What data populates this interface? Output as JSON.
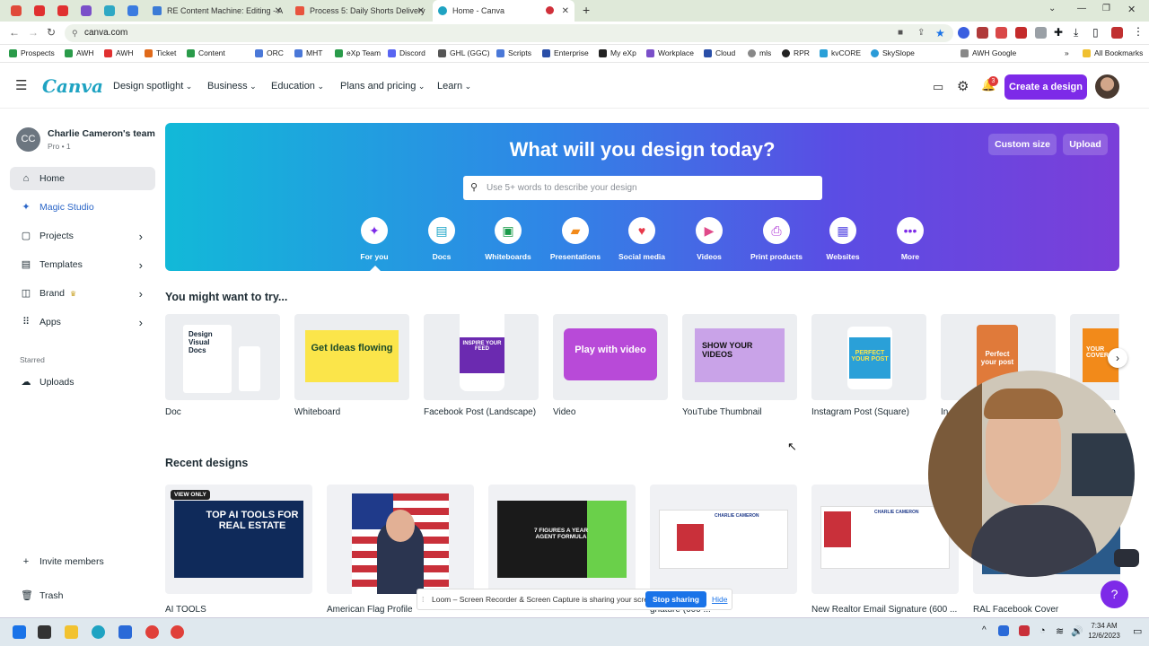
{
  "browser": {
    "tabs": [
      {
        "label": "RE Content Machine: Editing - A",
        "fav": "#3b7bd6"
      },
      {
        "label": "Process 5: Daily Shorts Delivery",
        "fav": "#e8543e"
      },
      {
        "label": "Home - Canva",
        "fav": "#1fa3c2"
      }
    ],
    "url": "canva.com",
    "bookmarks": [
      "Prospects",
      "AWH",
      "AWH",
      "Ticket",
      "Content",
      "ORC",
      "MHT",
      "eXp Team",
      "Discord",
      "GHL (GGC)",
      "Scripts",
      "Enterprise",
      "My eXp",
      "Workplace",
      "Cloud",
      "mls",
      "RPR",
      "kvCORE",
      "SkySlope",
      "AWH Google"
    ],
    "all_bookmarks": "All Bookmarks"
  },
  "header": {
    "logo": "Canva",
    "nav": [
      "Design spotlight",
      "Business",
      "Education",
      "Plans and pricing",
      "Learn"
    ],
    "notif_count": "3",
    "create_label": "Create a design"
  },
  "sidebar": {
    "team_initials": "CC",
    "team_name": "Charlie Cameron's team",
    "team_meta": "Pro • 1",
    "items": [
      {
        "label": "Home",
        "icon": "home-icon"
      },
      {
        "label": "Magic Studio",
        "icon": "magic-icon"
      },
      {
        "label": "Projects",
        "icon": "folder-icon"
      },
      {
        "label": "Templates",
        "icon": "template-icon"
      },
      {
        "label": "Brand",
        "icon": "brand-icon"
      },
      {
        "label": "Apps",
        "icon": "apps-icon"
      }
    ],
    "starred_label": "Starred",
    "uploads_label": "Uploads",
    "invite_label": "Invite members",
    "trash_label": "Trash"
  },
  "hero": {
    "title": "What will you design today?",
    "search_placeholder": "Use 5+ words to describe your design",
    "custom_size": "Custom size",
    "upload": "Upload",
    "categories": [
      "For you",
      "Docs",
      "Whiteboards",
      "Presentations",
      "Social media",
      "Videos",
      "Print products",
      "Websites",
      "More"
    ]
  },
  "try": {
    "title": "You might want to try...",
    "items": [
      {
        "label": "Doc",
        "thumb": "Design Visual Docs"
      },
      {
        "label": "Whiteboard",
        "thumb": "Get Ideas flowing"
      },
      {
        "label": "Facebook Post (Landscape)",
        "thumb": "INSPIRE YOUR FEED"
      },
      {
        "label": "Video",
        "thumb": "Play with video"
      },
      {
        "label": "YouTube Thumbnail",
        "thumb": "SHOW YOUR VIDEOS"
      },
      {
        "label": "Instagram Post (Square)",
        "thumb": "PERFECT YOUR POST"
      },
      {
        "label": "In",
        "thumb": "Perfect your post"
      },
      {
        "label": "Co",
        "thumb": "YOUR COVER"
      }
    ]
  },
  "recent": {
    "title": "Recent designs",
    "view_only": "VIEW ONLY",
    "items": [
      {
        "label": "AI TOOLS",
        "thumb": "TOP AI TOOLS FOR REAL ESTATE"
      },
      {
        "label": "American Flag Profile",
        "thumb": ""
      },
      {
        "label": "",
        "thumb": "7 FIGURES A YEAR AGENT FORMULA"
      },
      {
        "label": "gnature (600 ...",
        "thumb": "CHARLIE CAMERON"
      },
      {
        "label": "New Realtor Email Signature (600 ...",
        "thumb": "CHARLIE CAMERON"
      },
      {
        "label": "RAL Facebook Cover",
        "thumb": ""
      }
    ]
  },
  "loom": {
    "message": "Loom – Screen Recorder & Screen Capture is sharing your screen.",
    "stop": "Stop sharing",
    "hide": "Hide"
  },
  "taskbar": {
    "time": "7:34 AM",
    "date": "12/6/2023"
  },
  "colors": {
    "accent": "#7d2ae8",
    "logo": "#1fa3c2"
  }
}
